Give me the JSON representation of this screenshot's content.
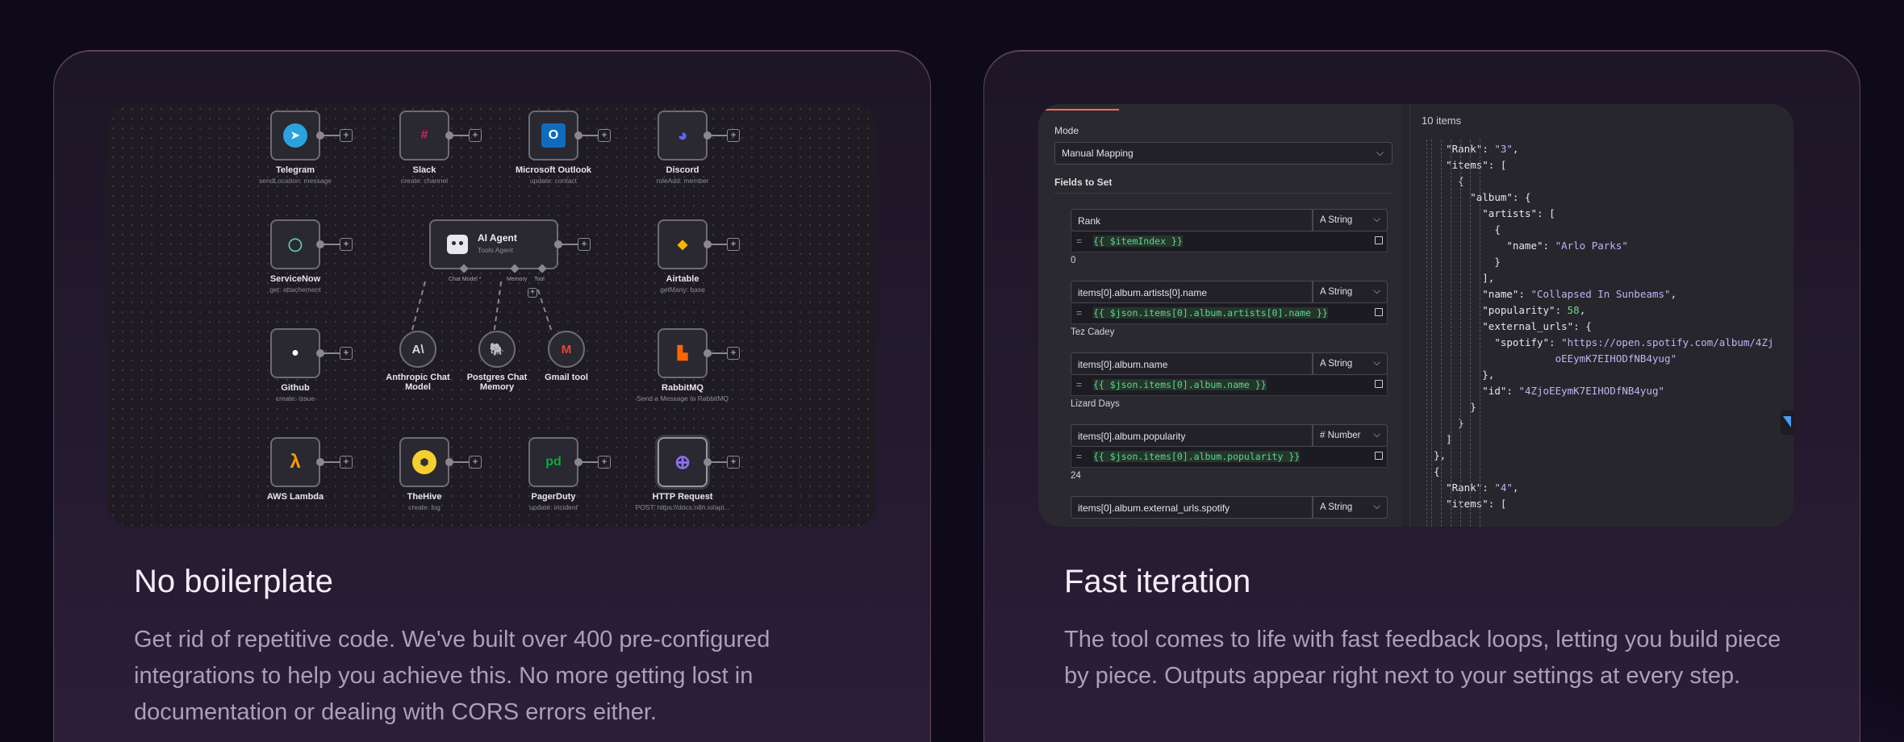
{
  "cards": [
    {
      "title": "No boilerplate",
      "description": "Get rid of repetitive code. We've built over 400 pre-configured integrations to help you achieve this. No more getting lost in documentation or dealing with CORS errors either."
    },
    {
      "title": "Fast iteration",
      "description": "The tool comes to life with fast feedback loops, letting you build piece by piece. Outputs appear right next to your settings at every step."
    }
  ],
  "workflow": {
    "nodes": [
      {
        "name": "Telegram",
        "sub": "sendLocation: message",
        "color": "#2aa3dd",
        "icon": "paper-plane-icon"
      },
      {
        "name": "Slack",
        "sub": "create: channel",
        "color": "#e01e5a",
        "icon": "slack-icon"
      },
      {
        "name": "Microsoft Outlook",
        "sub": "update: contact",
        "color": "#0f6cbd",
        "icon": "outlook-icon"
      },
      {
        "name": "Discord",
        "sub": "roleAdd: member",
        "color": "#5865f2",
        "icon": "discord-icon"
      },
      {
        "name": "ServiceNow",
        "sub": "get: attachement",
        "color": "#62d0a8",
        "icon": "servicenow-icon"
      },
      {
        "name": "Airtable",
        "sub": "getMany: base",
        "color": "#fcb400",
        "icon": "airtable-icon"
      },
      {
        "name": "Github",
        "sub": "create: issue",
        "color": "#ffffff",
        "icon": "github-icon"
      },
      {
        "name": "RabbitMQ",
        "sub": "Send a Message to RabbitMQ",
        "color": "#ff6600",
        "icon": "rabbitmq-icon"
      },
      {
        "name": "AWS Lambda",
        "sub": "",
        "color": "#ff9900",
        "icon": "lambda-icon"
      },
      {
        "name": "TheHive",
        "sub": "create: log",
        "color": "#f3d02f",
        "icon": "thehive-icon"
      },
      {
        "name": "PagerDuty",
        "sub": "update: incident",
        "color": "#06ac38",
        "icon": "pagerduty-icon"
      },
      {
        "name": "HTTP Request",
        "sub": "POST: https://docs.n8n.io/api...",
        "color": "#8c6ff0",
        "icon": "globe-icon"
      }
    ],
    "agent": {
      "title": "AI Agent",
      "sub": "Tools Agent",
      "links": [
        "Chat Model *",
        "Memory",
        "Tool"
      ]
    },
    "subnodes": [
      {
        "name": "Anthropic Chat Model",
        "glyph": "A\\",
        "color": "#d9d6dc"
      },
      {
        "name": "Postgres Chat Memory",
        "glyph": "🐘",
        "color": "#6aa0d8"
      },
      {
        "name": "Gmail tool",
        "glyph": "M",
        "color": "#ea4335"
      }
    ]
  },
  "editor": {
    "mode_label": "Mode",
    "mode_value": "Manual Mapping",
    "fields_label": "Fields to Set",
    "fields": [
      {
        "name": "Rank",
        "type": "String",
        "type_glyph": "A",
        "expr": "{{ $itemIndex }}",
        "value": "0"
      },
      {
        "name": "items[0].album.artists[0].name",
        "type": "String",
        "type_glyph": "A",
        "expr": "{{ $json.items[0].album.artists[0].name }}",
        "value": "Tez Cadey"
      },
      {
        "name": "items[0].album.name",
        "type": "String",
        "type_glyph": "A",
        "expr": "{{ $json.items[0].album.name }}",
        "value": "Lizard Days"
      },
      {
        "name": "items[0].album.popularity",
        "type": "Number",
        "type_glyph": "#",
        "expr": "{{ $json.items[0].album.popularity }}",
        "value": "24"
      },
      {
        "name": "items[0].album.external_urls.spotify",
        "type": "String",
        "type_glyph": "A",
        "expr": "",
        "value": ""
      }
    ],
    "output_count": "10 items",
    "json_lines": [
      {
        "indent": 1,
        "key": "\"Rank\"",
        "sep": ": ",
        "val": "\"3\"",
        "vt": "s",
        "tail": ","
      },
      {
        "indent": 1,
        "key": "\"items\"",
        "sep": ": ",
        "val": "",
        "vt": "s",
        "tail": "["
      },
      {
        "indent": 2,
        "key": "",
        "sep": "",
        "val": "",
        "vt": "s",
        "tail": "{"
      },
      {
        "indent": 3,
        "key": "\"album\"",
        "sep": ": ",
        "val": "",
        "vt": "s",
        "tail": "{"
      },
      {
        "indent": 4,
        "key": "\"artists\"",
        "sep": ": ",
        "val": "",
        "vt": "s",
        "tail": "["
      },
      {
        "indent": 5,
        "key": "",
        "sep": "",
        "val": "",
        "vt": "s",
        "tail": "{"
      },
      {
        "indent": 6,
        "key": "\"name\"",
        "sep": ": ",
        "val": "\"Arlo Parks\"",
        "vt": "s",
        "tail": ""
      },
      {
        "indent": 5,
        "key": "",
        "sep": "",
        "val": "",
        "vt": "s",
        "tail": "}"
      },
      {
        "indent": 4,
        "key": "",
        "sep": "",
        "val": "",
        "vt": "s",
        "tail": "],"
      },
      {
        "indent": 4,
        "key": "\"name\"",
        "sep": ": ",
        "val": "\"Collapsed In Sunbeams\"",
        "vt": "s",
        "tail": ","
      },
      {
        "indent": 4,
        "key": "\"popularity\"",
        "sep": ": ",
        "val": "58",
        "vt": "n",
        "tail": ","
      },
      {
        "indent": 4,
        "key": "\"external_urls\"",
        "sep": ": ",
        "val": "",
        "vt": "s",
        "tail": "{"
      },
      {
        "indent": 5,
        "key": "\"spotify\"",
        "sep": ": ",
        "val": "\"https://open.spotify.com/album/4Zj",
        "vt": "s",
        "tail": ""
      },
      {
        "indent": 10,
        "key": "",
        "sep": "",
        "val": "oEEymK7EIHODfNB4yug\"",
        "vt": "s",
        "tail": ""
      },
      {
        "indent": 4,
        "key": "",
        "sep": "",
        "val": "",
        "vt": "s",
        "tail": "},"
      },
      {
        "indent": 4,
        "key": "\"id\"",
        "sep": ": ",
        "val": "\"4ZjoEEymK7EIHODfNB4yug\"",
        "vt": "s",
        "tail": ""
      },
      {
        "indent": 3,
        "key": "",
        "sep": "",
        "val": "",
        "vt": "s",
        "tail": "}"
      },
      {
        "indent": 2,
        "key": "",
        "sep": "",
        "val": "",
        "vt": "s",
        "tail": "}"
      },
      {
        "indent": 1,
        "key": "",
        "sep": "",
        "val": "",
        "vt": "s",
        "tail": "]"
      },
      {
        "indent": 0,
        "key": "",
        "sep": "",
        "val": "",
        "vt": "s",
        "tail": "},"
      },
      {
        "indent": 0,
        "key": "",
        "sep": "",
        "val": "",
        "vt": "s",
        "tail": "{"
      },
      {
        "indent": 1,
        "key": "\"Rank\"",
        "sep": ": ",
        "val": "\"4\"",
        "vt": "s",
        "tail": ","
      },
      {
        "indent": 1,
        "key": "\"items\"",
        "sep": ": ",
        "val": "",
        "vt": "s",
        "tail": "["
      }
    ]
  }
}
